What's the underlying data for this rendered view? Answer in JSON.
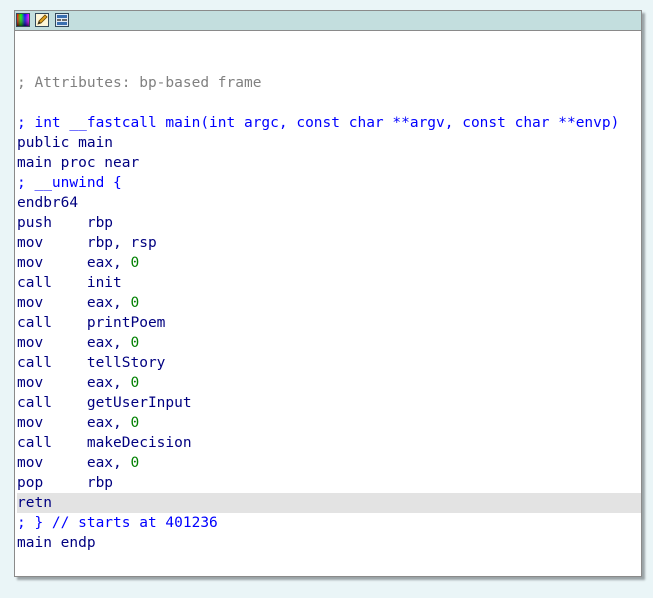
{
  "colors": {
    "background": "#eaf5f7",
    "titlebar": "#c3dede",
    "comment": "#808080",
    "keyword": "#0000ff",
    "number": "#008000",
    "text": "#000080",
    "highlight": "#e3e3e3"
  },
  "toolbar": {
    "icons": [
      "color-palette-icon",
      "edit-pencil-icon",
      "graph-view-icon"
    ]
  },
  "listing": {
    "attributes_comment": "; Attributes: bp-based frame",
    "signature_comment": "; int __fastcall main(int argc, const char **argv, const char **envp)",
    "public": "public main",
    "proc": "main proc near",
    "unwind": "; __unwind {",
    "instructions": [
      {
        "mnemonic": "endbr64",
        "operand": "",
        "number": ""
      },
      {
        "mnemonic": "push",
        "operand": "rbp",
        "number": ""
      },
      {
        "mnemonic": "mov",
        "operand": "rbp, rsp",
        "number": ""
      },
      {
        "mnemonic": "mov",
        "operand": "eax, ",
        "number": "0"
      },
      {
        "mnemonic": "call",
        "operand": "init",
        "number": ""
      },
      {
        "mnemonic": "mov",
        "operand": "eax, ",
        "number": "0"
      },
      {
        "mnemonic": "call",
        "operand": "printPoem",
        "number": ""
      },
      {
        "mnemonic": "mov",
        "operand": "eax, ",
        "number": "0"
      },
      {
        "mnemonic": "call",
        "operand": "tellStory",
        "number": ""
      },
      {
        "mnemonic": "mov",
        "operand": "eax, ",
        "number": "0"
      },
      {
        "mnemonic": "call",
        "operand": "getUserInput",
        "number": ""
      },
      {
        "mnemonic": "mov",
        "operand": "eax, ",
        "number": "0"
      },
      {
        "mnemonic": "call",
        "operand": "makeDecision",
        "number": ""
      },
      {
        "mnemonic": "mov",
        "operand": "eax, ",
        "number": "0"
      },
      {
        "mnemonic": "pop",
        "operand": "rbp",
        "number": ""
      },
      {
        "mnemonic": "retn",
        "operand": "",
        "number": ""
      }
    ],
    "end_comment": "; } // starts at 401236",
    "endp": "main endp"
  }
}
